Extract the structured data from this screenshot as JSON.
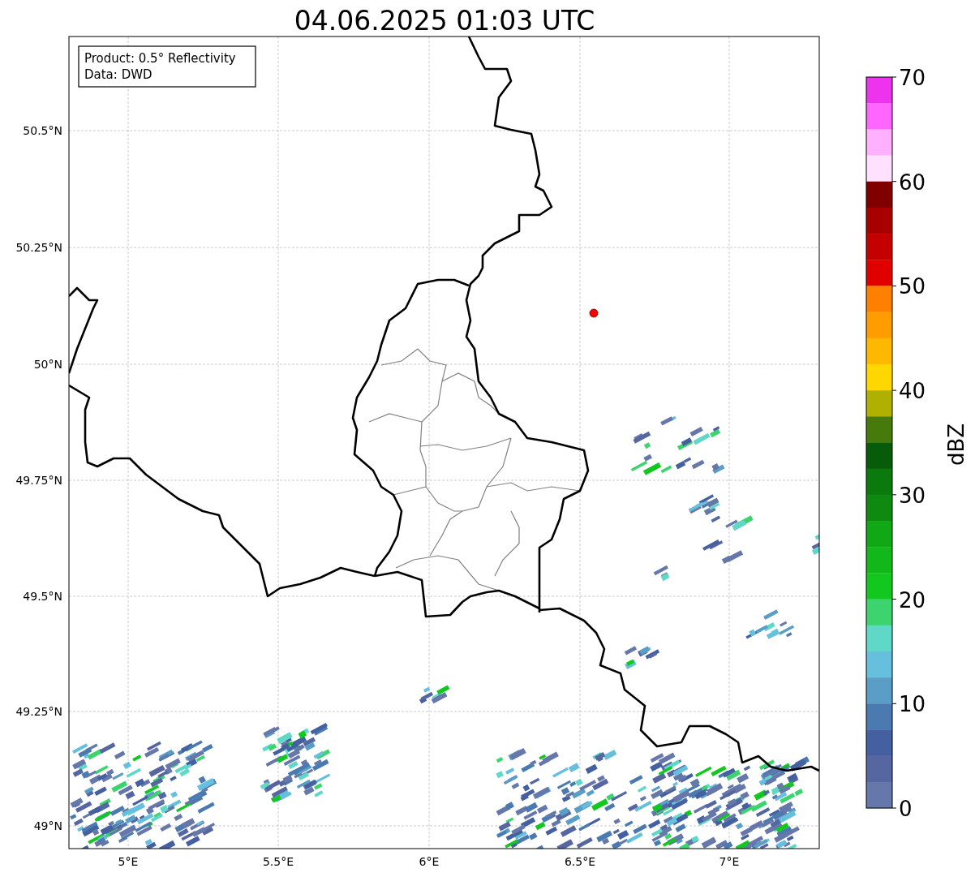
{
  "title": "04.06.2025 01:03 UTC",
  "info_box": {
    "lines": [
      "Product: 0.5° Reflectivity",
      "Data: DWD"
    ]
  },
  "map": {
    "radar_site": {
      "color": "#ff0000"
    },
    "lon_ticks": [
      "5°E",
      "5.5°E",
      "6°E",
      "6.5°E",
      "7°E"
    ],
    "lat_ticks": [
      "50.5°N",
      "50.25°N",
      "50°N",
      "49.75°N",
      "49.5°N",
      "49.25°N",
      "49°N"
    ]
  },
  "colorbar": {
    "label": "dBZ",
    "ticks": [
      "70",
      "60",
      "50",
      "40",
      "30",
      "20",
      "10",
      "0"
    ],
    "bins": [
      {
        "color": "#ee33ee"
      },
      {
        "color": "#ff66ff"
      },
      {
        "color": "#ffb0ff"
      },
      {
        "color": "#ffe0ff"
      },
      {
        "color": "#800000"
      },
      {
        "color": "#a80000"
      },
      {
        "color": "#c40000"
      },
      {
        "color": "#e00000"
      },
      {
        "color": "#ff8000"
      },
      {
        "color": "#ff9c00"
      },
      {
        "color": "#ffb800"
      },
      {
        "color": "#ffd700"
      },
      {
        "color": "#b0b000"
      },
      {
        "color": "#467a0b"
      },
      {
        "color": "#065c08"
      },
      {
        "color": "#0b7a0d"
      },
      {
        "color": "#0e8a10"
      },
      {
        "color": "#10a814"
      },
      {
        "color": "#12b81a"
      },
      {
        "color": "#12c81f"
      },
      {
        "color": "#3dd46f"
      },
      {
        "color": "#60d8c8"
      },
      {
        "color": "#66c0dd"
      },
      {
        "color": "#5a9ec8"
      },
      {
        "color": "#4a7ab0"
      },
      {
        "color": "#4460a0"
      },
      {
        "color": "#5566a0"
      },
      {
        "color": "#6677aa"
      }
    ]
  }
}
